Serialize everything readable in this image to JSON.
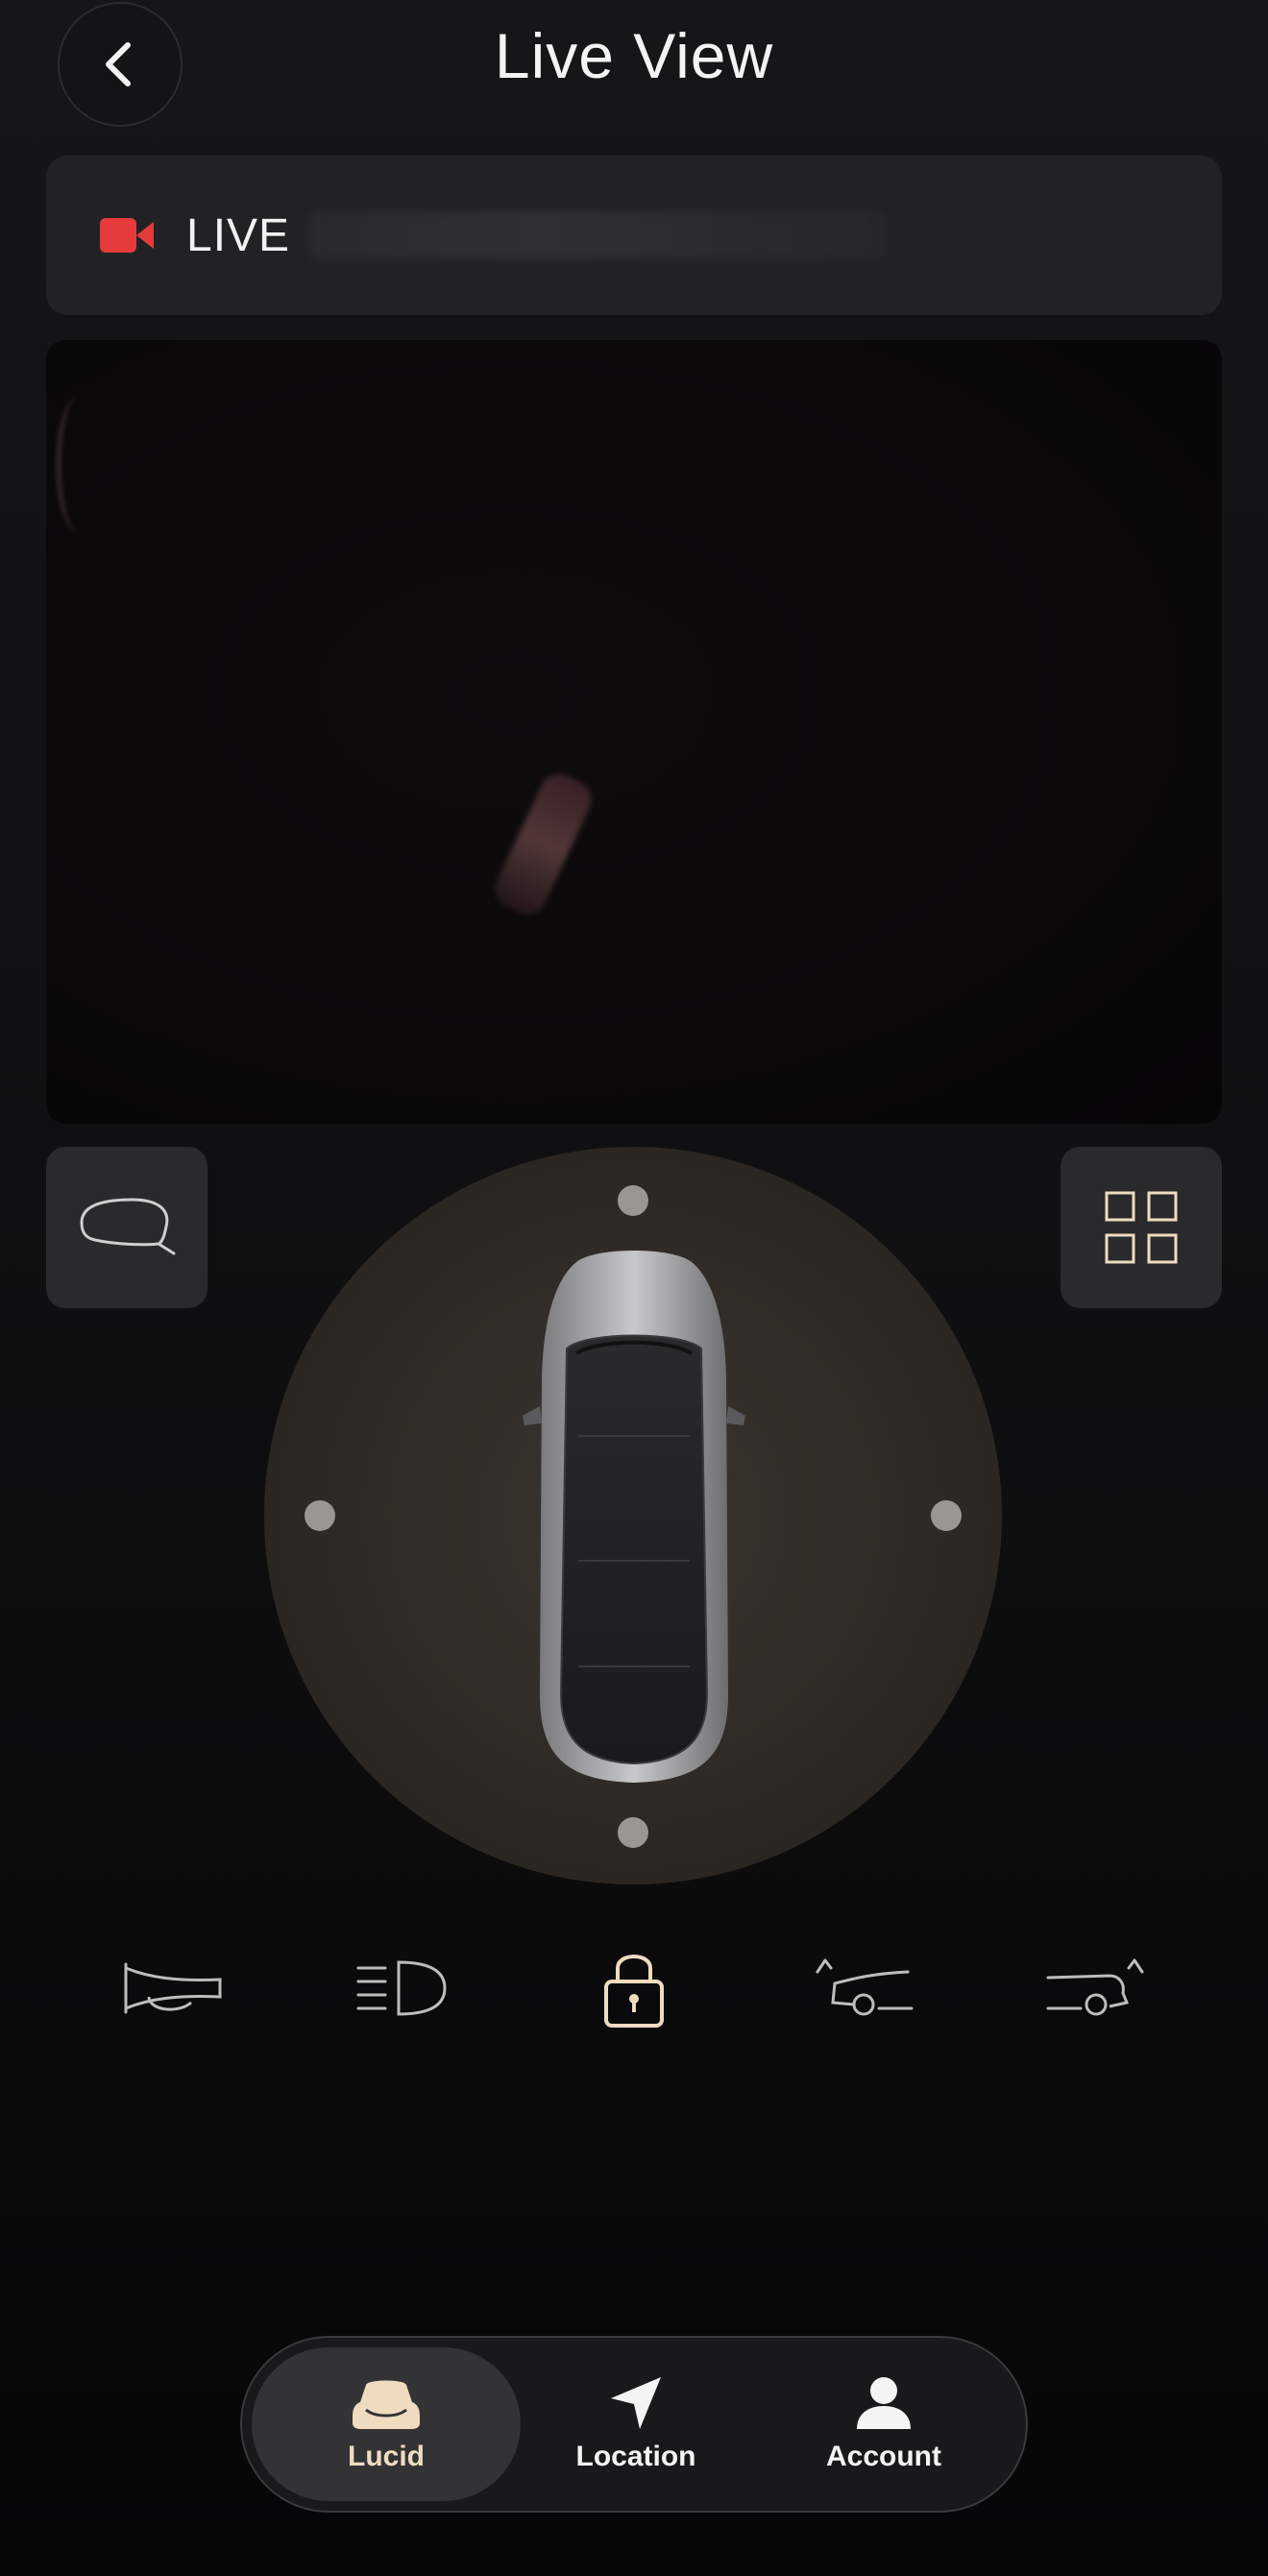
{
  "header": {
    "title": "Live View"
  },
  "live_banner": {
    "label": "LIVE",
    "status_color": "#e53b3b"
  },
  "accent_color": "#efdcc0",
  "controls": {
    "left_button_icon": "mirror-icon",
    "right_button_icon": "grid-icon"
  },
  "actions": [
    {
      "name": "horn",
      "icon": "horn-icon"
    },
    {
      "name": "headlights",
      "icon": "headlights-icon"
    },
    {
      "name": "lock",
      "icon": "lock-icon"
    },
    {
      "name": "frunk",
      "icon": "frunk-open-icon"
    },
    {
      "name": "trunk",
      "icon": "trunk-open-icon"
    }
  ],
  "nav": {
    "items": [
      {
        "label": "Lucid",
        "icon": "car-icon",
        "active": true
      },
      {
        "label": "Location",
        "icon": "location-arrow-icon",
        "active": false
      },
      {
        "label": "Account",
        "icon": "person-icon",
        "active": false
      }
    ]
  }
}
